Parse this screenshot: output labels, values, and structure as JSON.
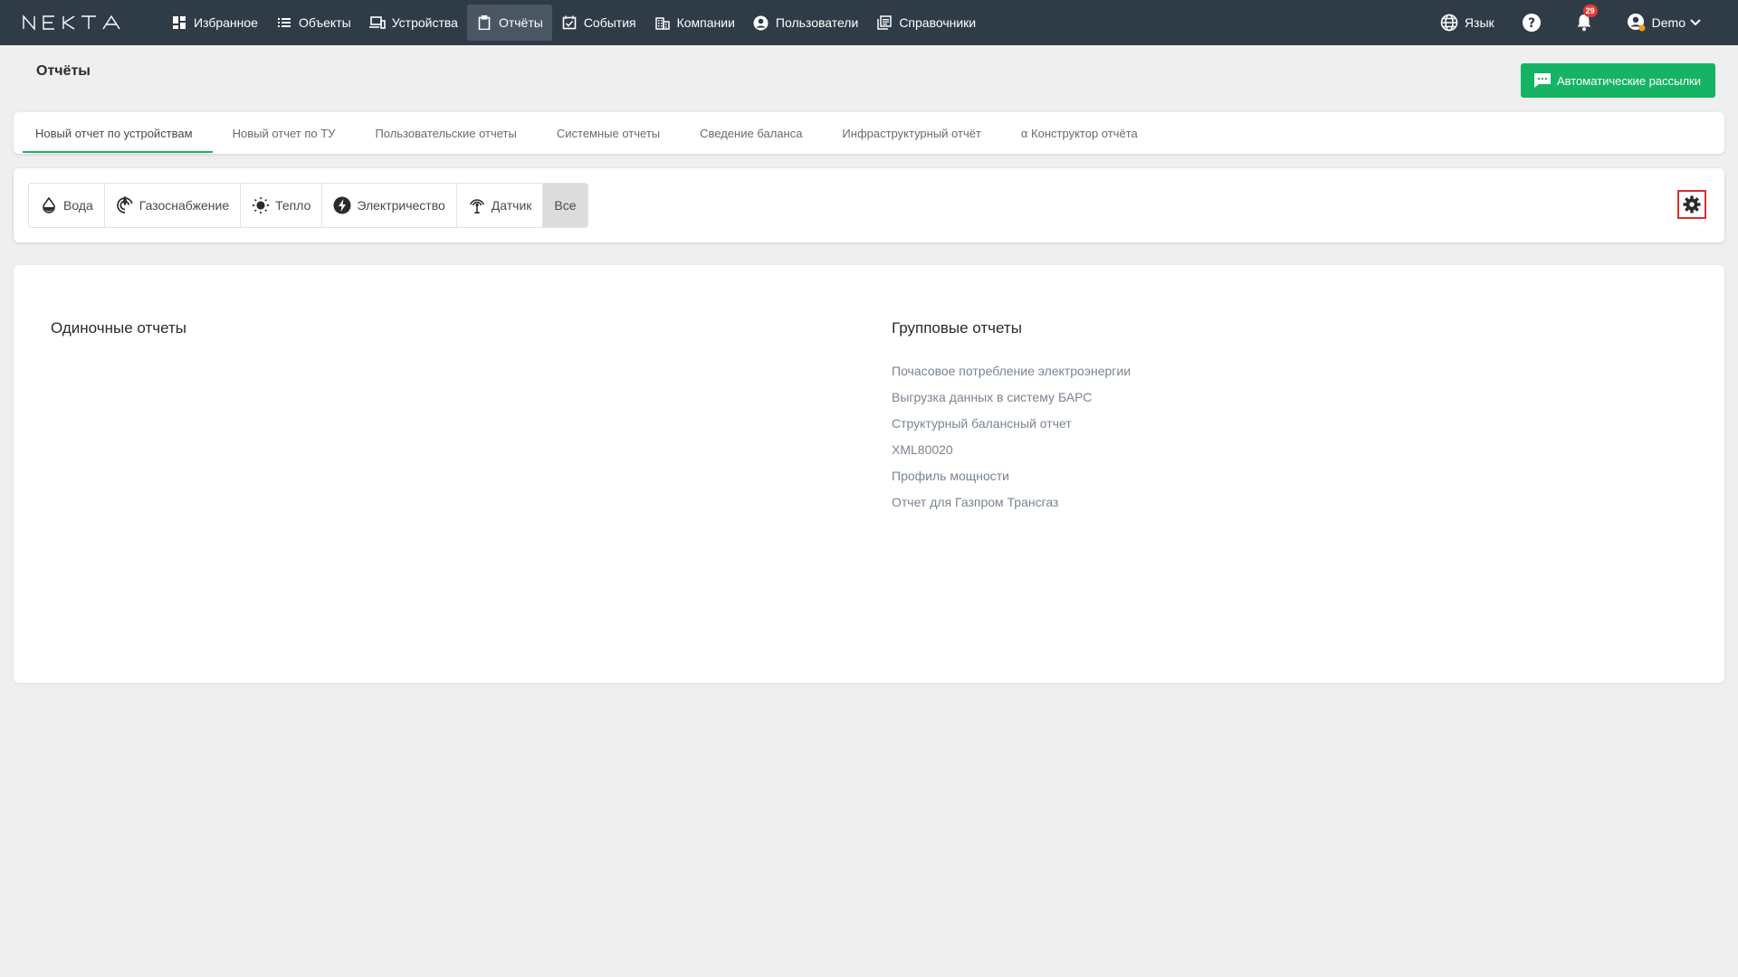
{
  "brand": {
    "logo_text": "NEKTA"
  },
  "nav": {
    "items": [
      {
        "label": "Избранное",
        "icon": "dashboard-icon"
      },
      {
        "label": "Объекты",
        "icon": "list-icon"
      },
      {
        "label": "Устройства",
        "icon": "devices-icon"
      },
      {
        "label": "Отчёты",
        "icon": "clipboard-icon",
        "active": true
      },
      {
        "label": "События",
        "icon": "event-check-icon"
      },
      {
        "label": "Компании",
        "icon": "building-icon"
      },
      {
        "label": "Пользователи",
        "icon": "account-circle-icon"
      },
      {
        "label": "Справочники",
        "icon": "library-books-icon"
      }
    ],
    "language_label": "Язык",
    "notification_count": "29",
    "user_label": "Demo"
  },
  "page": {
    "title": "Отчёты",
    "auto_button_label": "Автоматические рассылки"
  },
  "tabs": [
    {
      "label": "Новый отчет по устройствам",
      "active": true
    },
    {
      "label": "Новый отчет по ТУ"
    },
    {
      "label": "Пользовательские отчеты"
    },
    {
      "label": "Системные отчеты"
    },
    {
      "label": "Сведение баланса"
    },
    {
      "label": "Инфраструктурный отчёт"
    },
    {
      "label": "α Конструктор отчёта"
    }
  ],
  "filters": [
    {
      "label": "Вода",
      "icon": "water-drop-icon"
    },
    {
      "label": "Газоснабжение",
      "icon": "gas-icon"
    },
    {
      "label": "Тепло",
      "icon": "sun-icon"
    },
    {
      "label": "Электричество",
      "icon": "lightning-icon"
    },
    {
      "label": "Датчик",
      "icon": "antenna-icon"
    },
    {
      "label": "Все",
      "icon": "",
      "selected": true
    }
  ],
  "reports": {
    "single_title": "Одиночные отчеты",
    "group_title": "Групповые отчеты",
    "group_items": [
      "Почасовое потребление электроэнергии",
      "Выгрузка данных в систему БАРС",
      "Структурный балансный отчет",
      "XML80020",
      "Профиль мощности",
      "Отчет для Газпром Трансгаз"
    ]
  },
  "colors": {
    "topbar": "#2f3c48",
    "accent_green": "#16b364",
    "highlight_red": "#d32f2f"
  }
}
